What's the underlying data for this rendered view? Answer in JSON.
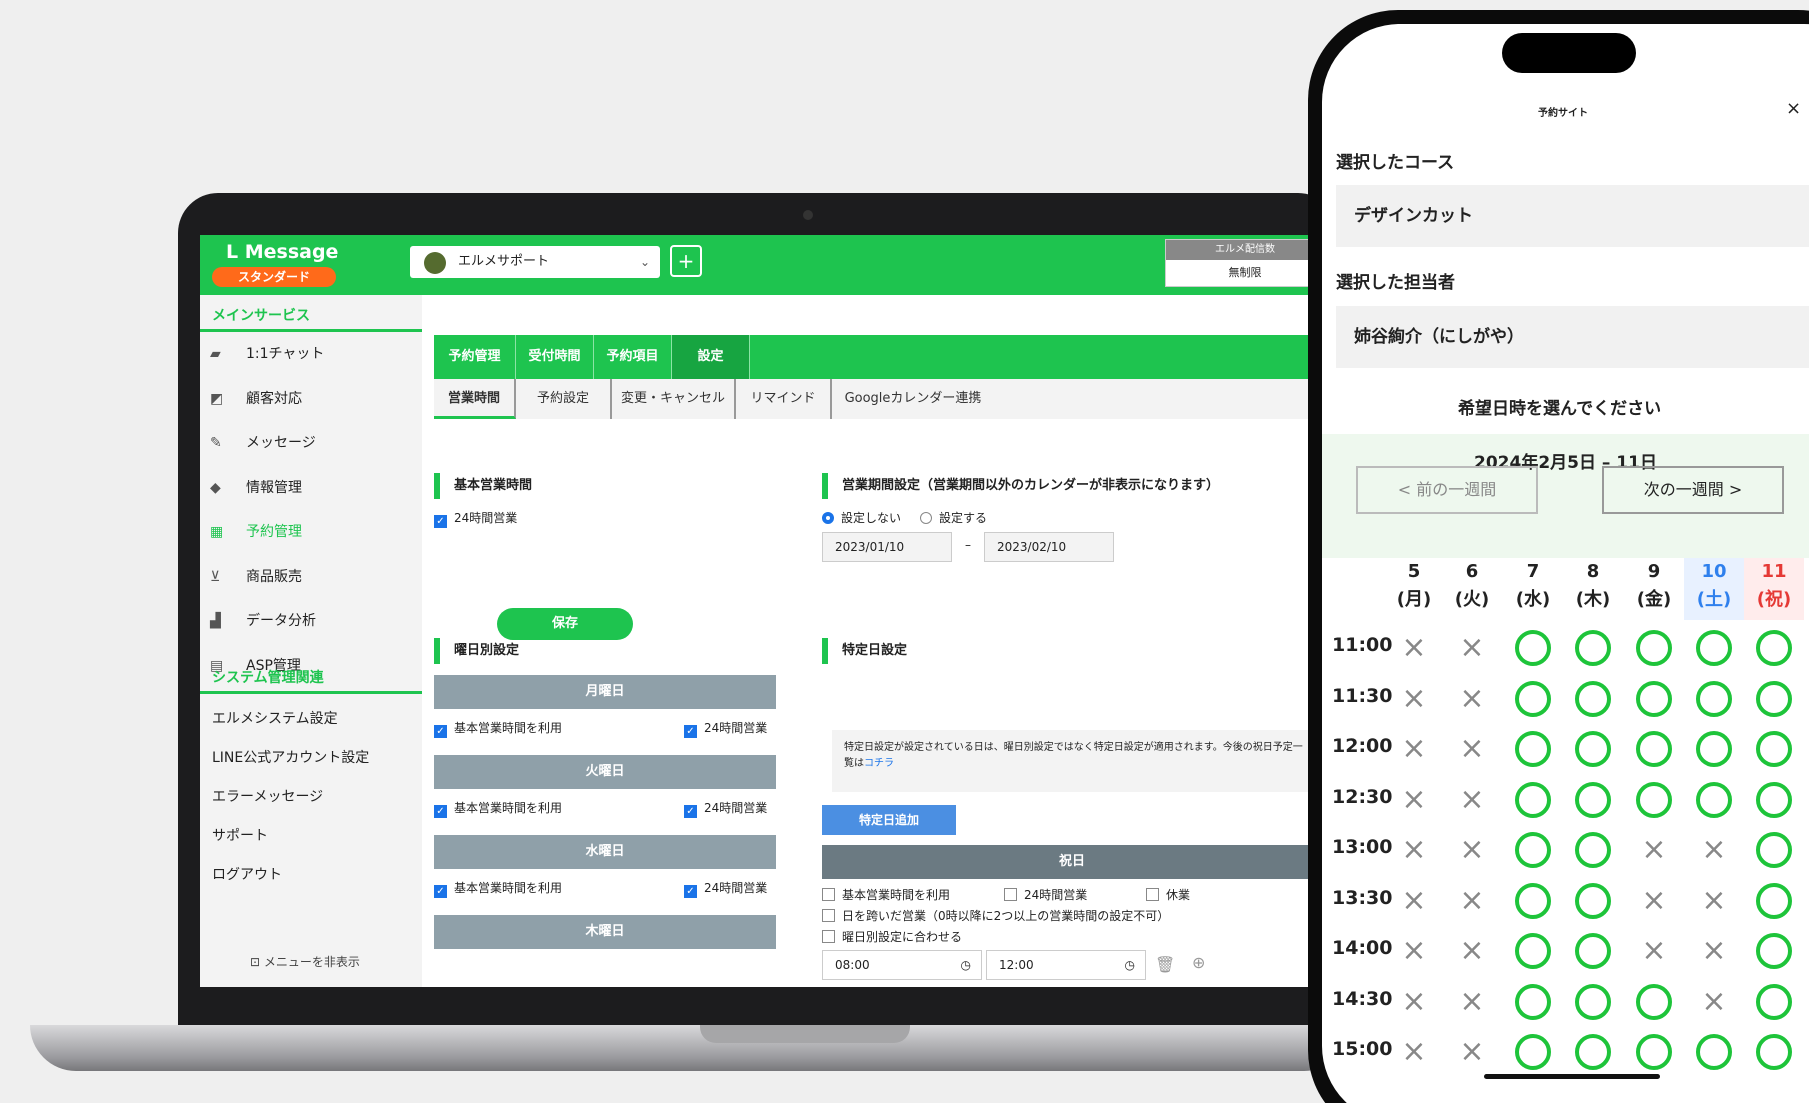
{
  "app": {
    "logo": "L Message",
    "plan": "スタンダード",
    "account": "エルメサポート",
    "quota_label": "エルメ配信数",
    "quota_value": "無制限"
  },
  "sidebar": {
    "section1": "メインサービス",
    "items": [
      {
        "label": "1:1チャット",
        "icon": "chat-icon",
        "glyph": "▰"
      },
      {
        "label": "顧客対応",
        "icon": "arrow-box-icon",
        "glyph": "◩"
      },
      {
        "label": "メッセージ",
        "icon": "edit-message-icon",
        "glyph": "✎"
      },
      {
        "label": "情報管理",
        "icon": "tag-icon",
        "glyph": "◆"
      },
      {
        "label": "予約管理",
        "icon": "calendar-icon",
        "glyph": "▦"
      },
      {
        "label": "商品販売",
        "icon": "cart-icon",
        "glyph": "⊻"
      },
      {
        "label": "データ分析",
        "icon": "chart-icon",
        "glyph": "▟"
      },
      {
        "label": "ASP管理",
        "icon": "asp-icon",
        "glyph": "▤"
      }
    ],
    "section2": "システム管理関連",
    "sys_items": [
      "エルメシステム設定",
      "LINE公式アカウント設定",
      "エラーメッセージ",
      "サポート",
      "ログアウト"
    ],
    "hide": "メニューを非表示"
  },
  "tabs1": [
    "予約管理",
    "受付時間",
    "予約項目",
    "設定"
  ],
  "tabs2": [
    "営業時間",
    "予約設定",
    "変更・キャンセル",
    "リマインド",
    "Googleカレンダー連携"
  ],
  "basic": {
    "title": "基本営業時間",
    "check24": "24時間営業",
    "save": "保存"
  },
  "period": {
    "title": "営業期間設定（営業期間以外のカレンダーが非表示になります）",
    "opt1": "設定しない",
    "opt2": "設定する",
    "from": "2023/01/10",
    "to": "2023/02/10",
    "dash": "–"
  },
  "weekday": {
    "title": "曜日別設定",
    "days": [
      "月曜日",
      "火曜日",
      "水曜日",
      "木曜日"
    ],
    "use_basic": "基本営業時間を利用",
    "h24": "24時間営業"
  },
  "special": {
    "title": "特定日設定",
    "note": "特定日設定が設定されている日は、曜日別設定ではなく特定日設定が適用されます。今後の祝日予定一覧は",
    "link": "コチラ",
    "add": "特定日追加",
    "holiday": "祝日",
    "c1": "基本営業時間を利用",
    "c2": "24時間営業",
    "c3": "休業",
    "c4": "日を跨いだ営業（0時以降に2つ以上の営業時間の設定不可）",
    "c5": "曜日別設定に合わせる",
    "t1": "08:00",
    "t2": "12:00",
    "dash": "–"
  },
  "phone": {
    "site": "予約サイト",
    "close": "×",
    "course_label": "選択したコース",
    "course": "デザインカット",
    "staff_label": "選択した担当者",
    "staff": "姉谷絢介（にしがや）",
    "prompt": "希望日時を選んでください",
    "range": "2024年2月5日 – 11日",
    "prev": "< 前の一週間",
    "next": "次の一週間 >",
    "days": [
      {
        "d": "5",
        "w": "(月)"
      },
      {
        "d": "6",
        "w": "(火)"
      },
      {
        "d": "7",
        "w": "(水)"
      },
      {
        "d": "8",
        "w": "(木)"
      },
      {
        "d": "9",
        "w": "(金)"
      },
      {
        "d": "10",
        "w": "(土)"
      },
      {
        "d": "11",
        "w": "(祝)"
      }
    ],
    "times": [
      "11:00",
      "11:30",
      "12:00",
      "12:30",
      "13:00",
      "13:30",
      "14:00",
      "14:30",
      "15:00"
    ],
    "availability": [
      "xxooooo",
      "xxooooo",
      "xxooooo",
      "xxooooo",
      "xxooxxo",
      "xxooxxo",
      "xxooxxo",
      "xxoooxo",
      "xxooooo"
    ],
    "colors": {
      "available": "#1ec43a",
      "sat": "#2f80ed",
      "hol": "#e53935"
    }
  }
}
